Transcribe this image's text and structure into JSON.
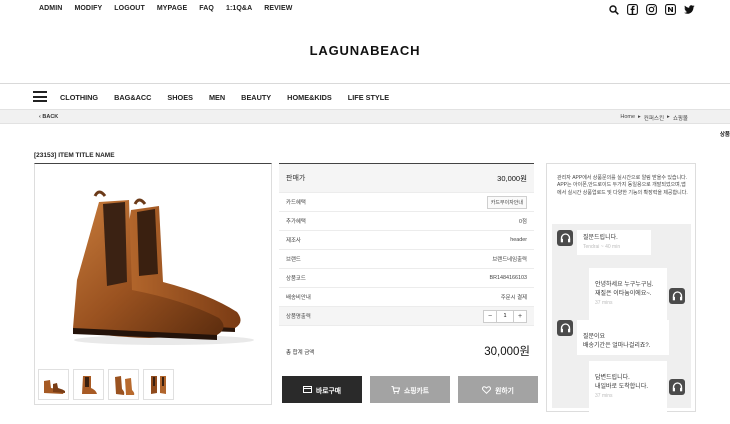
{
  "topnav": [
    "ADMIN",
    "MODIFY",
    "LOGOUT",
    "MYPAGE",
    "FAQ",
    "1:1Q&A",
    "REVIEW"
  ],
  "social_icons": [
    "search-icon",
    "facebook-icon",
    "instagram-icon",
    "naver-blog-icon",
    "twitter-icon"
  ],
  "logo": "LAGUNABEACH",
  "gnb": [
    "CLOTHING",
    "BAG&ACC",
    "SHOES",
    "MEN",
    "BEAUTY",
    "HOME&KIDS",
    "LIFE STYLE"
  ],
  "subbar": {
    "back": "BACK",
    "breadcrumb": [
      "Home",
      "▸",
      "컨퍼스킨",
      "▸",
      "쇼핑몰"
    ]
  },
  "side_label": "상품",
  "product": {
    "title": "[23153] ITEM TITLE NAME",
    "thumb_count": 4
  },
  "info": {
    "price_label": "판매가",
    "price_value": "30,000원",
    "rows": [
      {
        "label": "카드혜택",
        "value": "카드무이자안내",
        "is_button": true
      },
      {
        "label": "추가혜택",
        "value": "0점"
      },
      {
        "label": "제조사",
        "value": "header"
      },
      {
        "label": "브랜드",
        "value": "브랜드네임출력"
      },
      {
        "label": "상품코드",
        "value": "BR1484166103"
      },
      {
        "label": "배송비안내",
        "value": "주문시 결제"
      }
    ],
    "qty_label": "상품명출력",
    "qty_value": "1",
    "qty_minus": "−",
    "qty_plus": "+",
    "total_label": "총 합계 금액",
    "total_value": "30,000원"
  },
  "actions": {
    "buy": "바로구매",
    "cart": "쇼핑카트",
    "wish": "원하기"
  },
  "chat": {
    "intro": "관리자 APP에서 상품문의를 실시간으로 알림 받을수 있습니다. APP는 아이폰,안드로이드 두가지 동일용으로 개발되었으며,앱에서 실시간 상품업로드 및 다양한 기능의 확장력을 제공합니다.",
    "messages": [
      {
        "side": "left",
        "text": "질문드립니다.",
        "time": "Tendrai ~ 40 min"
      },
      {
        "side": "right",
        "text": "안녕하세요 누구누구님.\n재질은 이타늄이에요~.",
        "time": "37 mins"
      },
      {
        "side": "left",
        "text": "질문이요\n배송기간은 얼마나걸리죠?.",
        "time": ""
      },
      {
        "side": "right",
        "text": "답변드립니다.\n내일바로 도착합니다.",
        "time": "37 mins"
      }
    ]
  }
}
